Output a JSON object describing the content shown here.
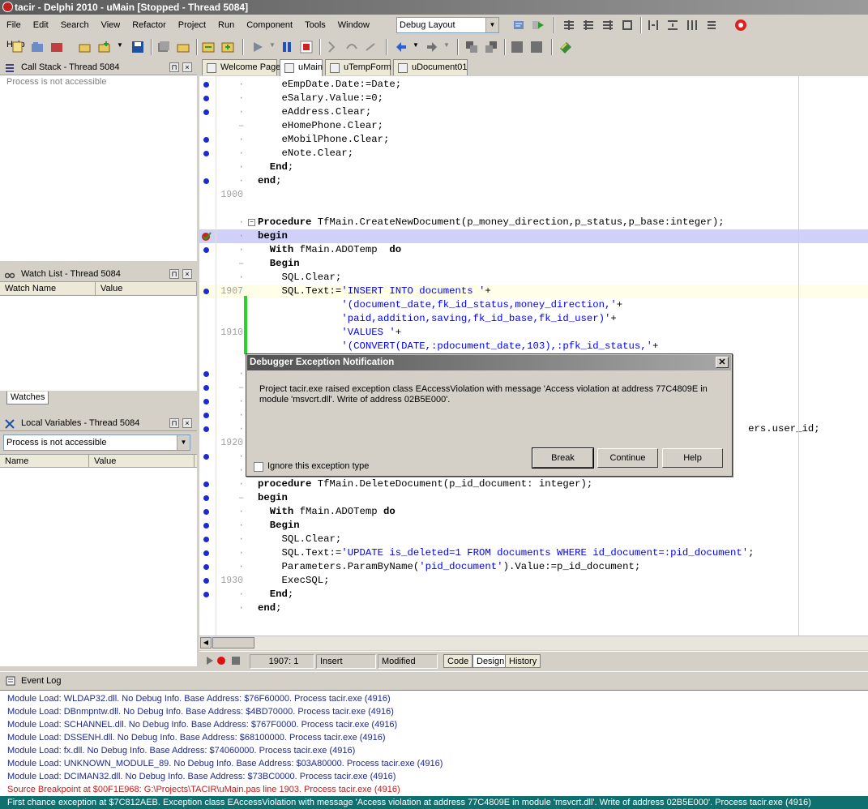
{
  "window": {
    "title": "tacir - Delphi 2010 - uMain [Stopped - Thread 5084]"
  },
  "menu": [
    "File",
    "Edit",
    "Search",
    "View",
    "Refactor",
    "Project",
    "Run",
    "Component",
    "Tools",
    "Window",
    "Help"
  ],
  "layout_combo": {
    "value": "Debug Layout"
  },
  "call_stack": {
    "title": "Call Stack - Thread 5084",
    "message": "Process is not accessible"
  },
  "watch_list": {
    "title": "Watch List - Thread 5084",
    "col_name": "Watch Name",
    "col_value": "Value",
    "tab": "Watches"
  },
  "local_vars": {
    "title": "Local Variables - Thread 5084",
    "combo": "Process is not accessible",
    "col_name": "Name",
    "col_value": "Value"
  },
  "editor_tabs": [
    "Welcome Page",
    "uMain",
    "uTempForm",
    "uDocument01"
  ],
  "code_lines": [
    {
      "text": "    eEmpDate.Date:=Date;"
    },
    {
      "text": "    eSalary.Value:=0;"
    },
    {
      "text": "    eAddress.Clear;"
    },
    {
      "text": "    eHomePhone.Clear;"
    },
    {
      "text": "    eMobilPhone.Clear;"
    },
    {
      "text": "    eNote.Clear;"
    },
    {
      "text": "  End;"
    },
    {
      "text": "end;"
    },
    {
      "text": "",
      "ln": "1900"
    },
    {
      "text": ""
    },
    {
      "text": "Procedure TfMain.CreateNewDocument(p_money_direction,p_status,p_base:integer);"
    },
    {
      "text": "begin"
    },
    {
      "text": "  With fMain.ADOTemp  do"
    },
    {
      "text": "  Begin"
    },
    {
      "text": "    SQL.Clear;"
    },
    {
      "text": "    SQL.Text:='INSERT INTO documents '+",
      "ln": "1907"
    },
    {
      "text": "              '(document_date,fk_id_status,money_direction,'+"
    },
    {
      "text": "              'paid,addition,saving,fk_id_base,fk_id_user)'+"
    },
    {
      "text": "              'VALUES '+",
      "ln": "1910"
    },
    {
      "text": "              '(CONVERT(DATE,:pdocument_date,103),:pfk_id_status,'+"
    },
    {
      "text": ""
    },
    {
      "text": ""
    },
    {
      "text": ""
    },
    {
      "text": ""
    },
    {
      "text": ""
    },
    {
      "text": "                                                                                  ers.user_id;"
    },
    {
      "text": "",
      "ln": "1920"
    },
    {
      "text": "end;"
    },
    {
      "text": ""
    },
    {
      "text": "procedure TfMain.DeleteDocument(p_id_document: integer);"
    },
    {
      "text": "begin"
    },
    {
      "text": "  With fMain.ADOTemp do"
    },
    {
      "text": "  Begin"
    },
    {
      "text": "    SQL.Clear;"
    },
    {
      "text": "    SQL.Text:='UPDATE is_deleted=1 FROM documents WHERE id_document=:pid_document';"
    },
    {
      "text": "    Parameters.ParamByName('pid_document').Value:=p_id_document;"
    },
    {
      "text": "    ExecSQL;",
      "ln": "1930"
    },
    {
      "text": "  End;"
    },
    {
      "text": "end;"
    }
  ],
  "status": {
    "position": "1907:  1",
    "mode": "Insert",
    "state": "Modified",
    "tabs": [
      "Code",
      "Design",
      "History"
    ]
  },
  "dialog": {
    "title": "Debugger Exception Notification",
    "message": "Project tacir.exe raised exception class EAccessViolation with message 'Access violation at address 77C4809E in module 'msvcrt.dll'. Write of address 02B5E000'.",
    "checkbox": "Ignore this exception type",
    "buttons": [
      "Break",
      "Continue",
      "Help"
    ]
  },
  "event_log": {
    "title": "Event Log",
    "entries": [
      "Module Load: WLDAP32.dll. No Debug Info. Base Address: $76F60000. Process tacir.exe (4916)",
      "Module Load: DBnmpntw.dll. No Debug Info. Base Address: $4BD70000. Process tacir.exe (4916)",
      "Module Load: SCHANNEL.dll. No Debug Info. Base Address: $767F0000. Process tacir.exe (4916)",
      "Module Load: DSSENH.dll. No Debug Info. Base Address: $68100000. Process tacir.exe (4916)",
      "Module Load: fx.dll. No Debug Info. Base Address: $74060000. Process tacir.exe (4916)",
      "Module Load: UNKNOWN_MODULE_89. No Debug Info. Base Address: $03A80000. Process tacir.exe (4916)",
      "Module Load: DCIMAN32.dll. No Debug Info. Base Address: $73BC0000. Process tacir.exe (4916)",
      "Source Breakpoint at $00F1E968: G:\\Projects\\TACIR\\uMain.pas line 1903. Process tacir.exe (4916)",
      "First chance exception at $7C812AEB. Exception class EAccessViolation with message 'Access violation at address 77C4809E in module 'msvcrt.dll'. Write of address 02B5E000'. Process tacir.exe (4916)"
    ]
  },
  "colors": {
    "breakpoint_dot": "#1c2ad0",
    "exec_line": "#d0d0f8",
    "log_text": "#1f2a8a",
    "log_error": "#c81818",
    "log_selected": "#107070"
  }
}
